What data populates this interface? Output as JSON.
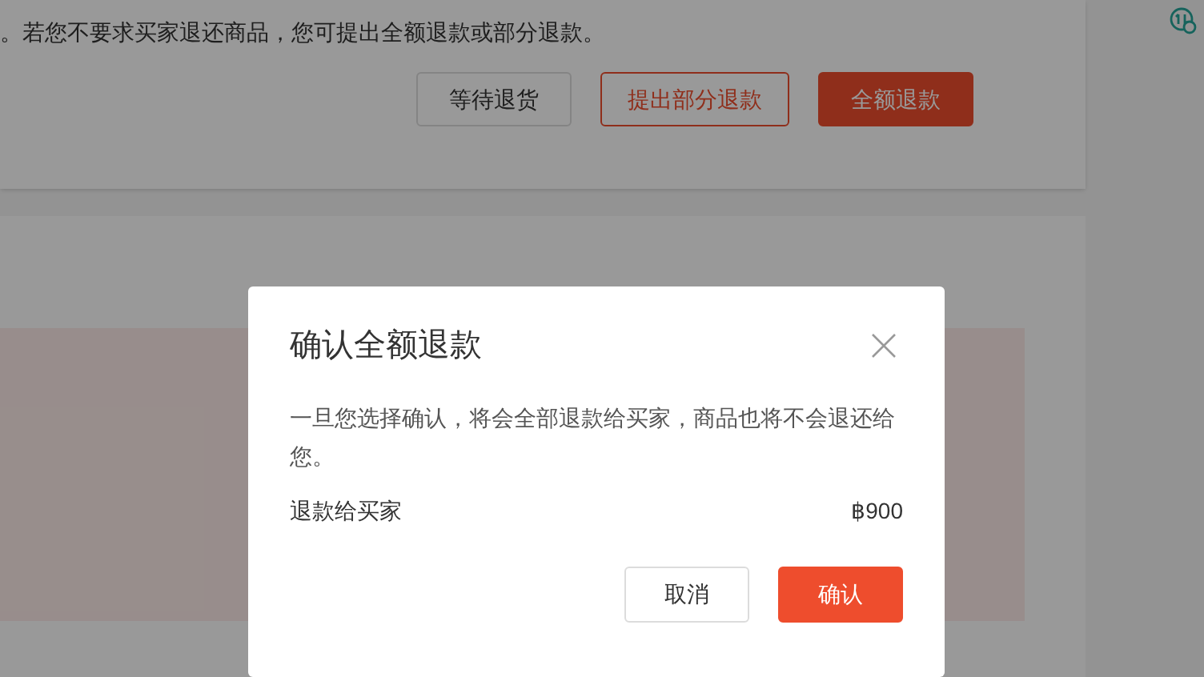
{
  "page": {
    "notice": "。若您不要求买家退还商品，您可提出全额退款或部分退款。",
    "actions": [
      {
        "label": "等待退货",
        "kind": "default"
      },
      {
        "label": "提出部分退款",
        "kind": "outline"
      },
      {
        "label": "全额退款",
        "kind": "primary"
      }
    ]
  },
  "dialog": {
    "title": "确认全额退款",
    "message": "一旦您选择确认，将会全部退款给买家，商品也将不会退还给您。",
    "amount_label": "退款给买家",
    "amount": "฿900",
    "buttons": [
      {
        "label": "取消",
        "kind": "default"
      },
      {
        "label": "确认",
        "kind": "primary"
      }
    ]
  }
}
